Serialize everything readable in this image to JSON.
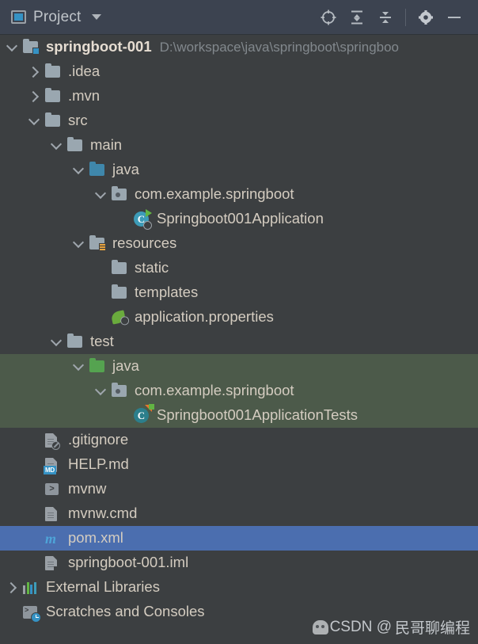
{
  "toolwindow": {
    "title": "Project",
    "icon": "project-window-icon",
    "dropdown_icon": "chevron-down-icon",
    "actions": [
      {
        "name": "select-opened-file-button",
        "icon": "crosshair-target-icon",
        "label": "Select Opened File"
      },
      {
        "name": "expand-all-button",
        "icon": "expand-all-icon",
        "label": "Expand All"
      },
      {
        "name": "collapse-all-button",
        "icon": "collapse-all-icon",
        "label": "Collapse All"
      },
      {
        "name": "settings-button",
        "icon": "gear-icon",
        "label": "Options"
      },
      {
        "name": "hide-button",
        "icon": "minimize-icon",
        "label": "Hide"
      }
    ]
  },
  "colors": {
    "header_bg": "#3c4350",
    "tree_bg": "#3c3f41",
    "selection_bg": "#4b6eaf",
    "test_source_highlight": "#4c5a4a",
    "text": "#d4ccc0",
    "muted_text": "#82888d",
    "source_root_blue": "#3f87ab",
    "test_root_green": "#55a350",
    "spring_green": "#6aab3d",
    "maven_blue": "#4ea4d8"
  },
  "tree": {
    "rows": [
      {
        "label": "springboot-001",
        "secondary": "D:\\workspace\\java\\springboot\\springboo",
        "depth": 0,
        "arrow": "expanded",
        "icon": "module-folder-icon",
        "bold": true,
        "state": "normal",
        "name": "tree-row-springboot-001"
      },
      {
        "label": ".idea",
        "secondary": "",
        "depth": 1,
        "arrow": "collapsed",
        "icon": "folder-icon",
        "bold": false,
        "state": "normal",
        "name": "tree-row-idea"
      },
      {
        "label": ".mvn",
        "secondary": "",
        "depth": 1,
        "arrow": "collapsed",
        "icon": "folder-icon",
        "bold": false,
        "state": "normal",
        "name": "tree-row-mvn"
      },
      {
        "label": "src",
        "secondary": "",
        "depth": 1,
        "arrow": "expanded",
        "icon": "folder-icon",
        "bold": false,
        "state": "normal",
        "name": "tree-row-src"
      },
      {
        "label": "main",
        "secondary": "",
        "depth": 2,
        "arrow": "expanded",
        "icon": "folder-icon",
        "bold": false,
        "state": "normal",
        "name": "tree-row-main"
      },
      {
        "label": "java",
        "secondary": "",
        "depth": 3,
        "arrow": "expanded",
        "icon": "source-root-folder-icon",
        "bold": false,
        "state": "normal",
        "name": "tree-row-main-java"
      },
      {
        "label": "com.example.springboot",
        "secondary": "",
        "depth": 4,
        "arrow": "expanded",
        "icon": "package-folder-icon",
        "bold": false,
        "state": "normal",
        "name": "tree-row-main-package"
      },
      {
        "label": "Springboot001Application",
        "secondary": "",
        "depth": 5,
        "arrow": "none",
        "icon": "spring-boot-class-run-icon",
        "bold": false,
        "state": "normal",
        "name": "tree-row-springboot001application"
      },
      {
        "label": "resources",
        "secondary": "",
        "depth": 3,
        "arrow": "expanded",
        "icon": "resources-folder-icon",
        "bold": false,
        "state": "normal",
        "name": "tree-row-resources"
      },
      {
        "label": "static",
        "secondary": "",
        "depth": 4,
        "arrow": "none",
        "icon": "folder-icon",
        "bold": false,
        "state": "normal",
        "name": "tree-row-static"
      },
      {
        "label": "templates",
        "secondary": "",
        "depth": 4,
        "arrow": "none",
        "icon": "folder-icon",
        "bold": false,
        "state": "normal",
        "name": "tree-row-templates"
      },
      {
        "label": "application.properties",
        "secondary": "",
        "depth": 4,
        "arrow": "none",
        "icon": "spring-properties-icon",
        "bold": false,
        "state": "normal",
        "name": "tree-row-application-properties"
      },
      {
        "label": "test",
        "secondary": "",
        "depth": 2,
        "arrow": "expanded",
        "icon": "folder-icon",
        "bold": false,
        "state": "normal",
        "name": "tree-row-test"
      },
      {
        "label": "java",
        "secondary": "",
        "depth": 3,
        "arrow": "expanded",
        "icon": "test-source-root-folder-icon",
        "bold": false,
        "state": "testhl",
        "name": "tree-row-test-java"
      },
      {
        "label": "com.example.springboot",
        "secondary": "",
        "depth": 4,
        "arrow": "expanded",
        "icon": "package-folder-icon",
        "bold": false,
        "state": "testhl",
        "name": "tree-row-test-package"
      },
      {
        "label": "Springboot001ApplicationTests",
        "secondary": "",
        "depth": 5,
        "arrow": "none",
        "icon": "test-class-icon",
        "bold": false,
        "state": "testhl",
        "name": "tree-row-springboot001applicationtests"
      },
      {
        "label": ".gitignore",
        "secondary": "",
        "depth": 1,
        "arrow": "none",
        "icon": "gitignore-file-icon",
        "bold": false,
        "state": "normal",
        "name": "tree-row-gitignore"
      },
      {
        "label": "HELP.md",
        "secondary": "",
        "depth": 1,
        "arrow": "none",
        "icon": "markdown-file-icon",
        "bold": false,
        "state": "normal",
        "name": "tree-row-help-md"
      },
      {
        "label": "mvnw",
        "secondary": "",
        "depth": 1,
        "arrow": "none",
        "icon": "shell-script-icon",
        "bold": false,
        "state": "normal",
        "name": "tree-row-mvnw"
      },
      {
        "label": "mvnw.cmd",
        "secondary": "",
        "depth": 1,
        "arrow": "none",
        "icon": "cmd-script-icon",
        "bold": false,
        "state": "normal",
        "name": "tree-row-mvnw-cmd"
      },
      {
        "label": "pom.xml",
        "secondary": "",
        "depth": 1,
        "arrow": "none",
        "icon": "maven-pom-icon",
        "bold": false,
        "state": "selected",
        "name": "tree-row-pom-xml"
      },
      {
        "label": "springboot-001.iml",
        "secondary": "",
        "depth": 1,
        "arrow": "none",
        "icon": "iml-module-file-icon",
        "bold": false,
        "state": "normal",
        "name": "tree-row-springboot-001-iml"
      },
      {
        "label": "External Libraries",
        "secondary": "",
        "depth": 0,
        "arrow": "collapsed",
        "icon": "external-libraries-icon",
        "bold": false,
        "state": "normal",
        "name": "tree-row-external-libraries"
      },
      {
        "label": "Scratches and Consoles",
        "secondary": "",
        "depth": 0,
        "arrow": "none",
        "icon": "scratches-consoles-icon",
        "bold": false,
        "state": "normal",
        "name": "tree-row-scratches-and-consoles"
      }
    ]
  },
  "watermark": {
    "prefix": "CSDN @",
    "author": "民哥聊编程",
    "icon": "csdn-avatar-icon"
  }
}
